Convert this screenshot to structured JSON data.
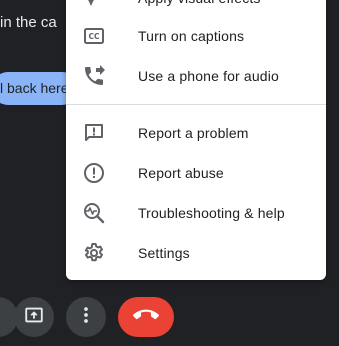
{
  "background": {
    "meeting_text": "in the ca",
    "pill_text": "l back here"
  },
  "menu": {
    "items": [
      {
        "label": "Apply visual effects",
        "icon": "sparkle-icon"
      },
      {
        "label": "Turn on captions",
        "icon": "closed-captions-icon"
      },
      {
        "label": "Use a phone for audio",
        "icon": "phone-forward-icon"
      },
      {
        "label": "Report a problem",
        "icon": "feedback-icon"
      },
      {
        "label": "Report abuse",
        "icon": "report-icon"
      },
      {
        "label": "Troubleshooting & help",
        "icon": "troubleshoot-icon"
      },
      {
        "label": "Settings",
        "icon": "gear-icon"
      }
    ]
  },
  "controls": {
    "present": {
      "icon": "present-screen-icon"
    },
    "more": {
      "icon": "more-vert-icon"
    },
    "end_call": {
      "icon": "call-end-icon",
      "color": "#ea4335"
    }
  },
  "colors": {
    "background": "#202124",
    "menu": "#ffffff",
    "pill": "#8ab4f8",
    "end_call": "#ea4335"
  }
}
